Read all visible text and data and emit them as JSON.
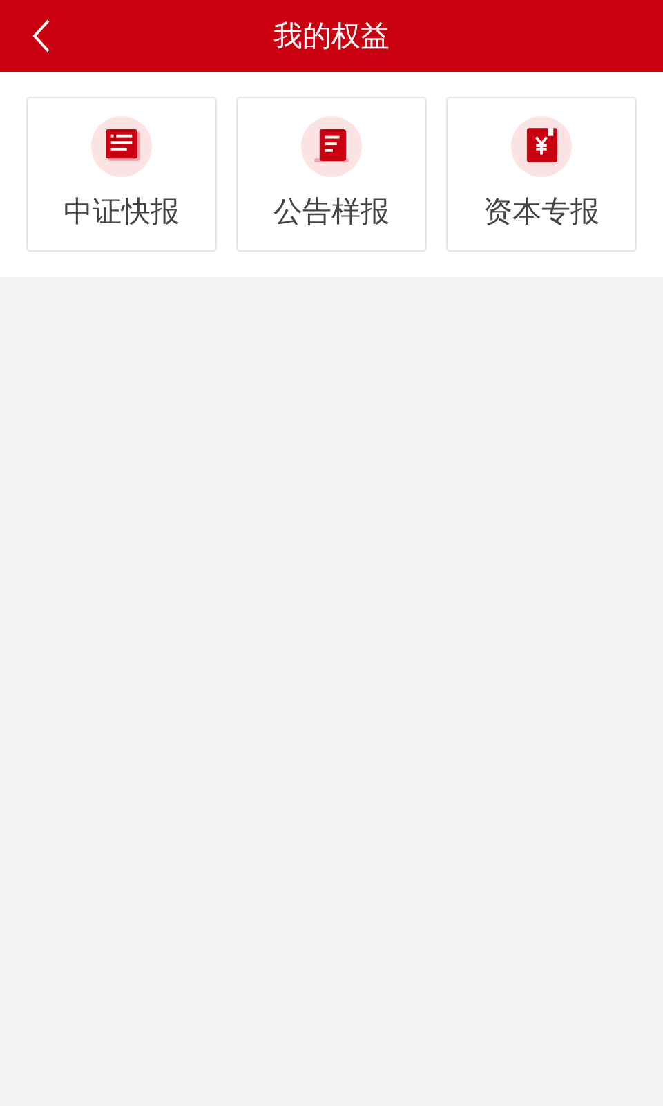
{
  "header": {
    "title": "我的权益"
  },
  "cards": [
    {
      "kind": "news",
      "label": "中证快报"
    },
    {
      "kind": "scroll",
      "label": "公告样报"
    },
    {
      "kind": "money",
      "label": "资本专报"
    }
  ]
}
